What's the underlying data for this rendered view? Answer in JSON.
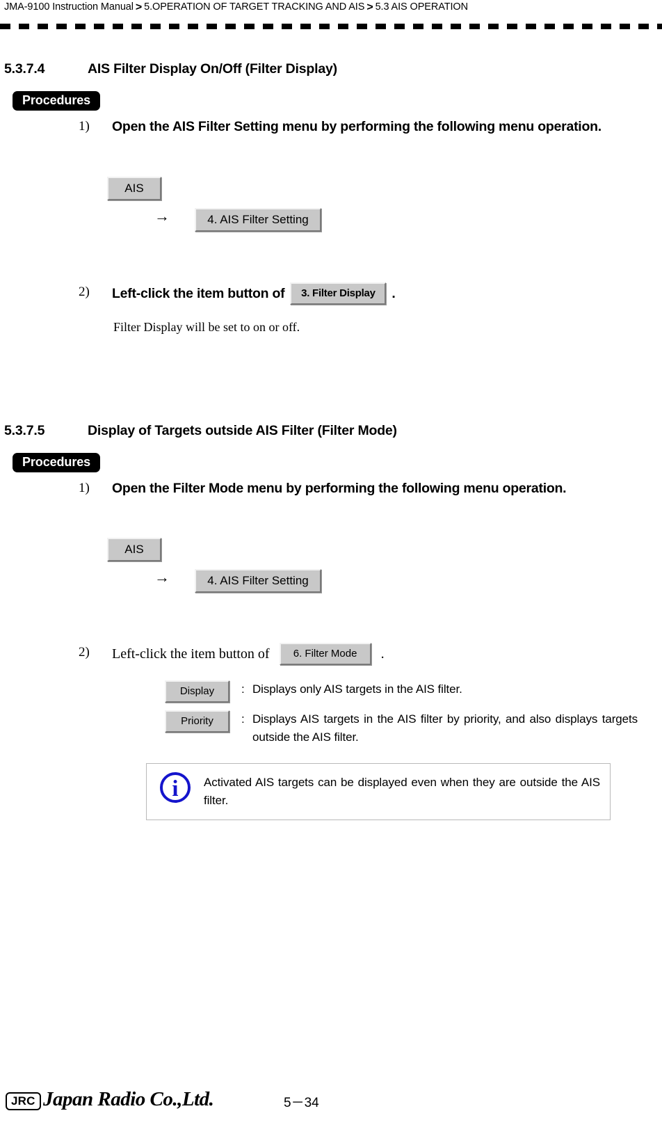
{
  "header": {
    "manual_title": "JMA-9100 Instruction Manual",
    "separator": ">",
    "crumb_chapter": "5.OPERATION OF TARGET TRACKING AND AIS",
    "crumb_section": "5.3  AIS OPERATION"
  },
  "sections": [
    {
      "number": "5.3.7.4",
      "title": "AIS Filter Display On/Off (Filter Display)",
      "procedures_label": "Procedures",
      "step1": {
        "num": "1)",
        "text": "Open the AIS Filter Setting menu by performing the following menu operation."
      },
      "menu_path": {
        "root_button": "AIS",
        "arrow": "→",
        "child_button": "4. AIS Filter Setting"
      },
      "step2": {
        "num": "2)",
        "text_before": "Left-click the item button of",
        "button": "3. Filter Display",
        "text_after": "."
      },
      "note": "Filter Display will be set to on or off."
    },
    {
      "number": "5.3.7.5",
      "title": "Display of Targets outside AIS Filter (Filter Mode)",
      "procedures_label": "Procedures",
      "step1": {
        "num": "1)",
        "text": "Open the Filter Mode menu by performing the following menu operation."
      },
      "menu_path": {
        "root_button": "AIS",
        "arrow": "→",
        "child_button": "4. AIS Filter Setting"
      },
      "step2": {
        "num": "2)",
        "text_before": "Left-click the item button of",
        "button": "6. Filter Mode",
        "text_after": "."
      },
      "options": [
        {
          "button": "Display",
          "colon": ":",
          "description": "Displays only AIS targets in the AIS filter."
        },
        {
          "button": "Priority",
          "colon": ":",
          "description": "Displays AIS targets in the AIS filter by priority, and also displays targets outside the AIS filter."
        }
      ],
      "info_box": {
        "icon": "information-icon",
        "icon_glyph": "i",
        "text": "Activated AIS targets can be displayed even when they are outside the AIS filter."
      }
    }
  ],
  "footer": {
    "logo_mark": "JRC",
    "company_name": "Japan Radio Co.,Ltd.",
    "page_number": "5－34"
  }
}
